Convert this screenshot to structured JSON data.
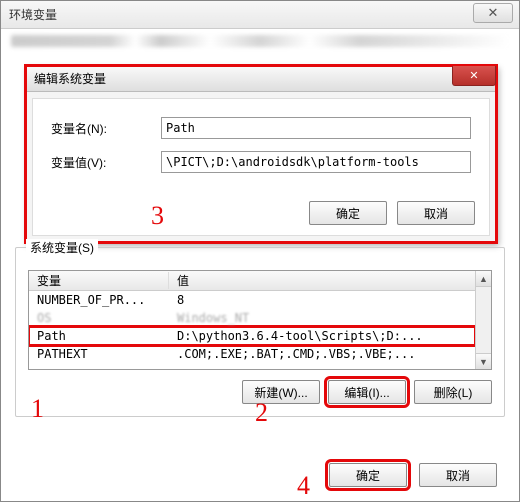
{
  "window": {
    "title": "环境变量",
    "close": "✕"
  },
  "edit_dialog": {
    "title": "编辑系统变量",
    "close": "✕",
    "name_label": "变量名(N):",
    "name_value": "Path",
    "value_label": "变量值(V):",
    "value_value": "\\PICT\\;D:\\androidsdk\\platform-tools",
    "ok": "确定",
    "cancel": "取消"
  },
  "sys": {
    "legend": "系统变量(S)",
    "col_var": "变量",
    "col_val": "值",
    "rows": [
      {
        "var": "NUMBER_OF_PR...",
        "val": "8"
      },
      {
        "var": "OS",
        "val": "Windows_NT"
      },
      {
        "var": "Path",
        "val": "D:\\python3.6.4-tool\\Scripts\\;D:..."
      },
      {
        "var": "PATHEXT",
        "val": ".COM;.EXE;.BAT;.CMD;.VBS;.VBE;..."
      }
    ],
    "btn_new": "新建(W)...",
    "btn_edit": "编辑(I)...",
    "btn_delete": "删除(L)"
  },
  "main": {
    "ok": "确定",
    "cancel": "取消"
  },
  "annotations": {
    "a1": "1",
    "a2": "2",
    "a3": "3",
    "a4": "4"
  }
}
